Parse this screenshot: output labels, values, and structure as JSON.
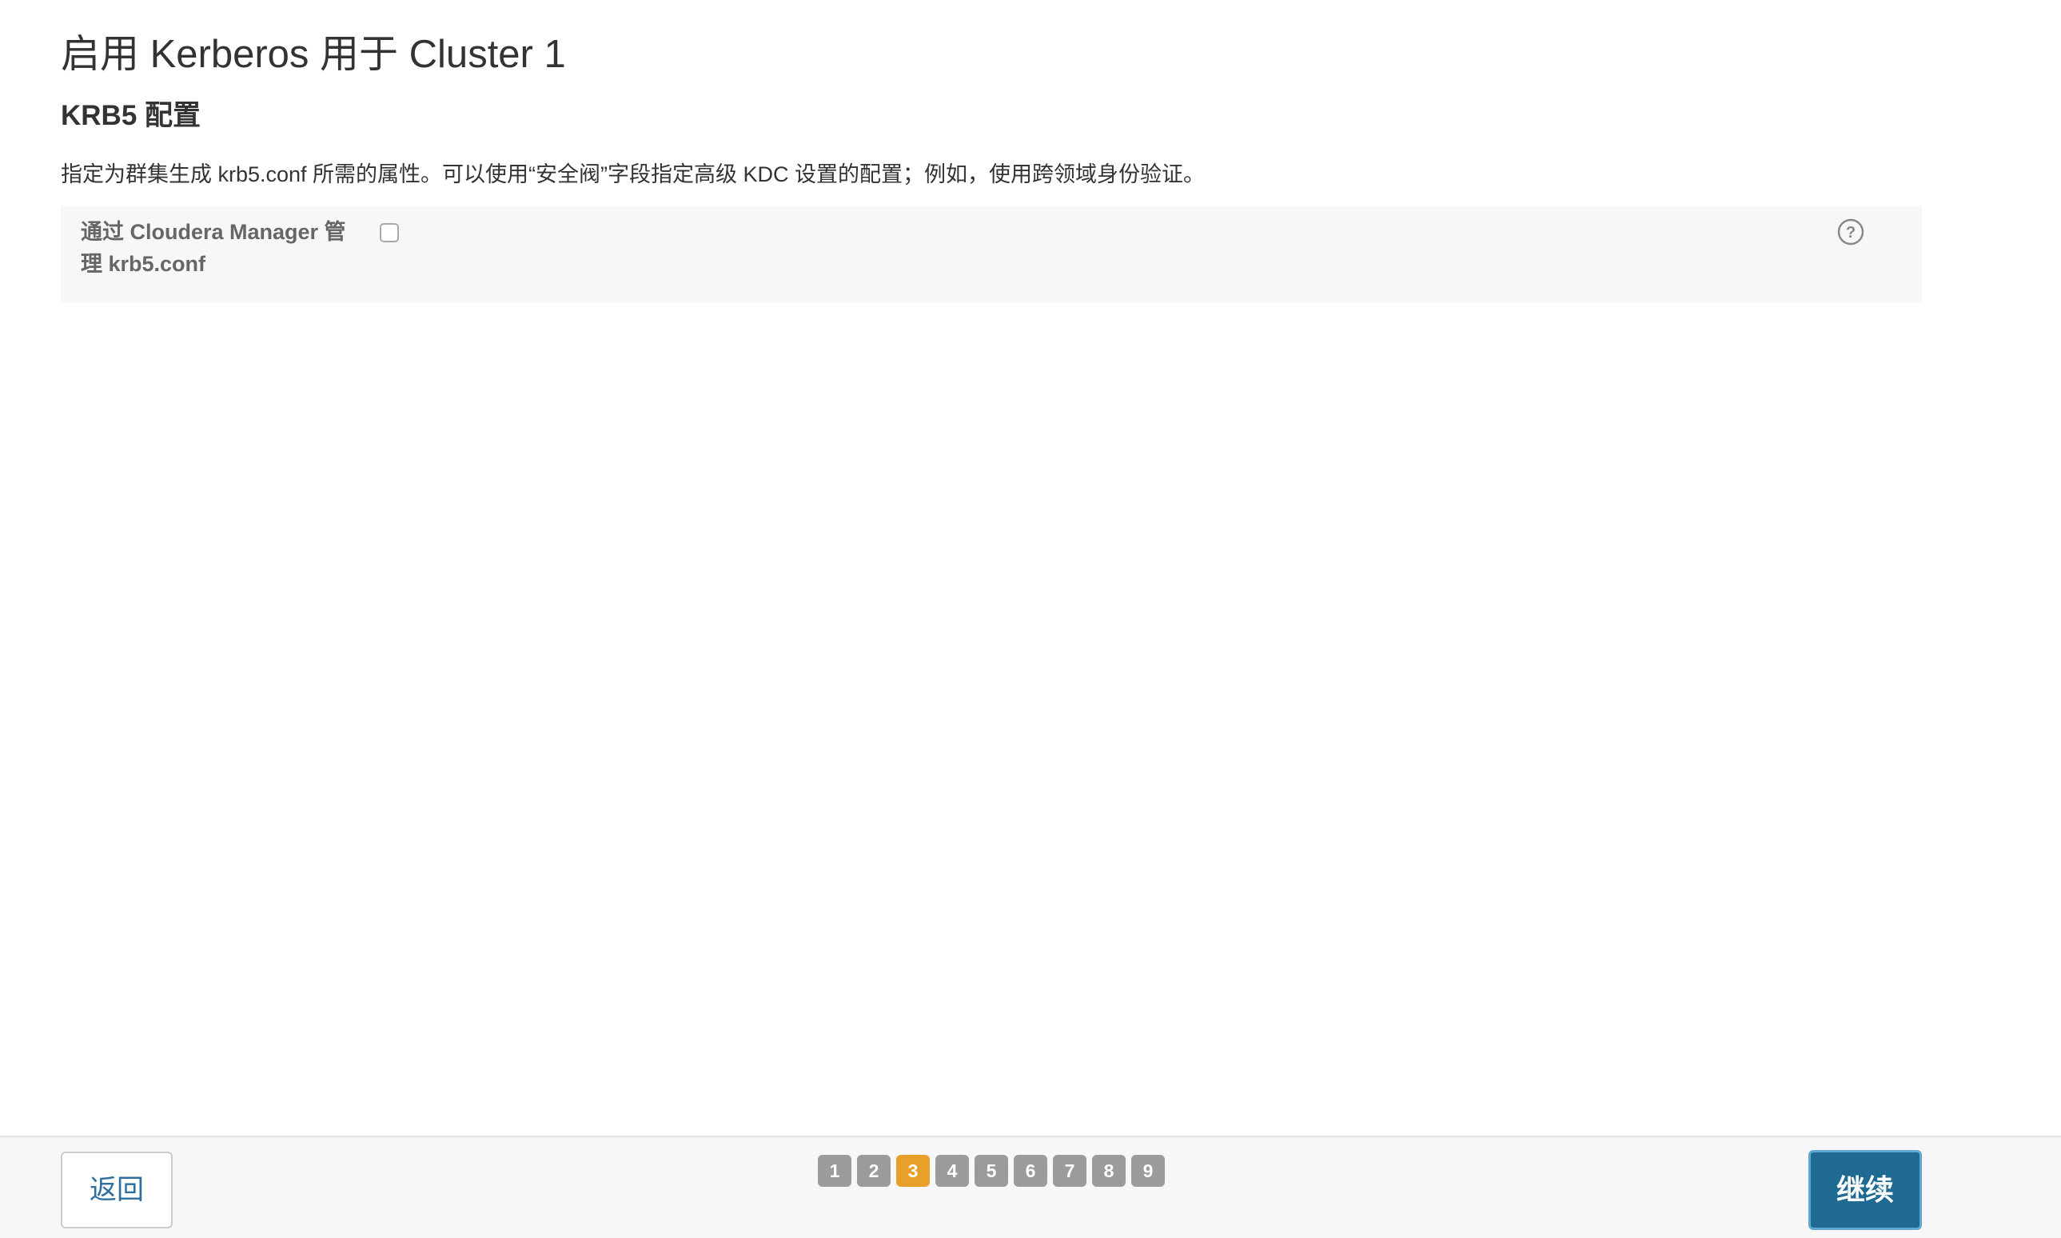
{
  "page": {
    "title": "启用 Kerberos 用于 Cluster 1",
    "section_title": "KRB5 配置",
    "description": "指定为群集生成 krb5.conf 所需的属性。可以使用“安全阀”字段指定高级 KDC 设置的配置；例如，使用跨领域身份验证。"
  },
  "config": {
    "label_line1": "通过 Cloudera Manager 管",
    "label_line2": "理 krb5.conf",
    "checked": false,
    "help_icon": "question-circle-icon"
  },
  "footer": {
    "back_label": "返回",
    "continue_label": "继续",
    "steps": [
      "1",
      "2",
      "3",
      "4",
      "5",
      "6",
      "7",
      "8",
      "9"
    ],
    "current_step": "3",
    "colors": {
      "step_default": "#9b9b9b",
      "step_active": "#e8a02a",
      "primary": "#1e6a93"
    }
  }
}
